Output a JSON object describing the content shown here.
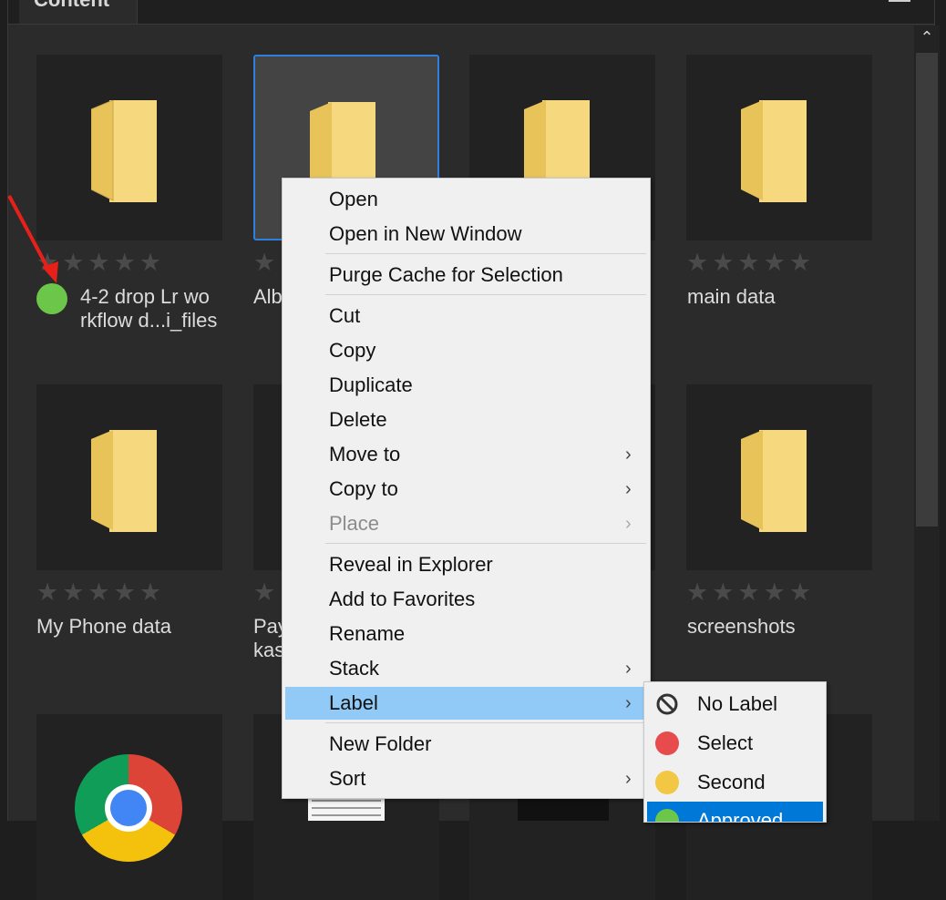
{
  "panel": {
    "tab_title": "Content"
  },
  "tiles": [
    {
      "name": "4-2 drop Lr wo rkflow d...i_files",
      "line1": "4-2 drop Lr wo",
      "line2": "rkflow d...i_files",
      "label_color": "#6cc64a"
    },
    {
      "name": "Alb",
      "line1": "Alb",
      "line2": ""
    },
    {
      "name": "main data",
      "line1": "main data",
      "line2": ""
    },
    {
      "name": "My Phone data",
      "line1": "My Phone data",
      "line2": ""
    },
    {
      "name": "Pay kas",
      "line1": "Pay",
      "line2": "kas"
    },
    {
      "name": "screenshots",
      "line1": "screenshots",
      "line2": ""
    }
  ],
  "stars": "★★★★★",
  "context_menu": {
    "items": [
      {
        "label": "Open"
      },
      {
        "label": "Open in New Window"
      },
      {
        "label": "Purge Cache for Selection"
      },
      {
        "label": "Cut"
      },
      {
        "label": "Copy"
      },
      {
        "label": "Duplicate"
      },
      {
        "label": "Delete"
      },
      {
        "label": "Move to",
        "submenu": true
      },
      {
        "label": "Copy to",
        "submenu": true
      },
      {
        "label": "Place",
        "submenu": true,
        "disabled": true
      },
      {
        "label": "Reveal in Explorer"
      },
      {
        "label": "Add to Favorites"
      },
      {
        "label": "Rename"
      },
      {
        "label": "Stack",
        "submenu": true
      },
      {
        "label": "Label",
        "submenu": true,
        "highlighted": true
      },
      {
        "label": "New Folder"
      },
      {
        "label": "Sort",
        "submenu": true
      }
    ],
    "submenu_arrow": "›"
  },
  "label_submenu": {
    "items": [
      {
        "label": "No Label",
        "icon": "no-label-icon"
      },
      {
        "label": "Select",
        "color": "#e84b4b"
      },
      {
        "label": "Second",
        "color": "#f2c744"
      },
      {
        "label": "Approved",
        "color": "#6cc64a",
        "highlighted": true
      }
    ]
  },
  "colors": {
    "selection_border": "#2f7fe0",
    "menu_highlight": "#91c9f7",
    "submenu_highlight": "#0078d7"
  }
}
